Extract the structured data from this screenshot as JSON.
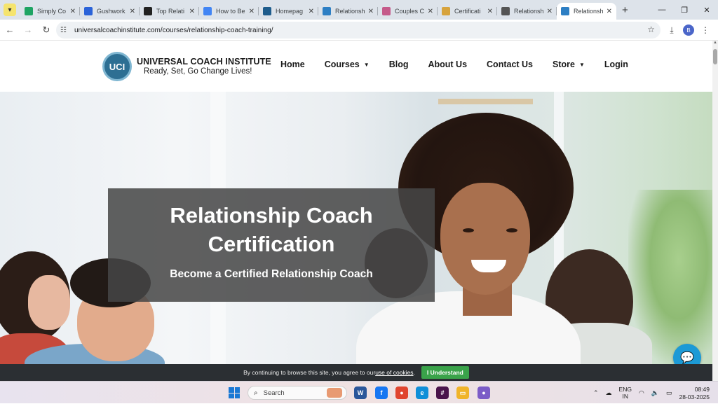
{
  "browser": {
    "tabs": [
      {
        "label": "Simply Co",
        "fav_color": "#1fa463",
        "active": false
      },
      {
        "label": "Gushwork",
        "fav_color": "#2b63d9",
        "active": false
      },
      {
        "label": "Top Relati",
        "fav_color": "#222222",
        "active": false
      },
      {
        "label": "How to Be",
        "fav_color": "#4285f4",
        "active": false
      },
      {
        "label": "Homepag",
        "fav_color": "#1e5c8c",
        "active": false
      },
      {
        "label": "Relationsh",
        "fav_color": "#2d7fc4",
        "active": false
      },
      {
        "label": "Couples C",
        "fav_color": "#c55a8a",
        "active": false
      },
      {
        "label": "Certificati",
        "fav_color": "#d7a33c",
        "active": false
      },
      {
        "label": "Relationsh",
        "fav_color": "#555555",
        "active": false
      },
      {
        "label": "Relationsh",
        "fav_color": "#2d7fc4",
        "active": true
      }
    ],
    "url": "universalcoachinstitute.com/courses/relationship-coach-training/",
    "profile_initial": "B"
  },
  "site": {
    "logo_text": "UCI",
    "brand_name": "UNIVERSAL COACH INSTITUTE",
    "tagline": "Ready, Set, Go Change Lives!",
    "nav": [
      {
        "label": "Home",
        "dropdown": false
      },
      {
        "label": "Courses",
        "dropdown": true
      },
      {
        "label": "Blog",
        "dropdown": false
      },
      {
        "label": "About Us",
        "dropdown": false
      },
      {
        "label": "Contact Us",
        "dropdown": false
      },
      {
        "label": "Store",
        "dropdown": true
      },
      {
        "label": "Login",
        "dropdown": false
      }
    ]
  },
  "hero": {
    "title_line1": "Relationship Coach",
    "title_line2": "Certification",
    "subtitle": "Become a Certified Relationship Coach"
  },
  "cookie": {
    "text": "By continuing to browse this site, you agree to our ",
    "link": "use of cookies",
    "suffix": ".",
    "button": "I Understand"
  },
  "taskbar": {
    "search_placeholder": "Search",
    "apps": [
      {
        "icon": "word-icon",
        "color": "#2b579a",
        "glyph": "W"
      },
      {
        "icon": "facebook-icon",
        "color": "#1877f2",
        "glyph": "f"
      },
      {
        "icon": "chrome-icon",
        "color": "#e0452f",
        "glyph": "●"
      },
      {
        "icon": "edge-icon",
        "color": "#0f8fd8",
        "glyph": "e"
      },
      {
        "icon": "slack-icon",
        "color": "#4a154b",
        "glyph": "#"
      },
      {
        "icon": "file-explorer-icon",
        "color": "#f0b429",
        "glyph": "▭"
      },
      {
        "icon": "chrome-profile-icon",
        "color": "#7b5cc7",
        "glyph": "●"
      }
    ],
    "lang_line1": "ENG",
    "lang_line2": "IN",
    "time": "08:49",
    "date": "28-03-2025"
  }
}
